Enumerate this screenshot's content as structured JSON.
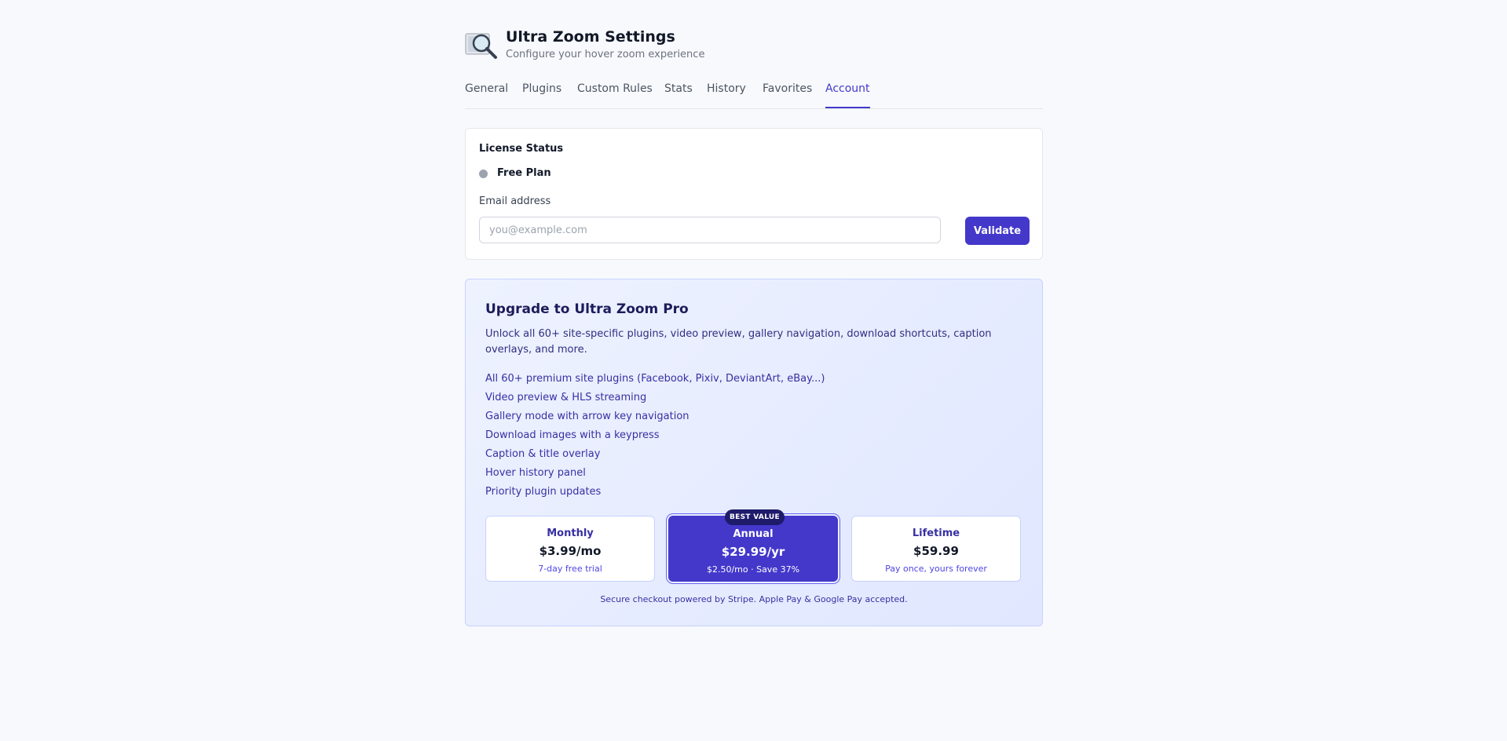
{
  "header": {
    "title": "Ultra Zoom Settings",
    "subtitle": "Configure your hover zoom experience",
    "logo_icon": "magnifier-over-image-icon"
  },
  "tabs": [
    {
      "label": "General",
      "active": false
    },
    {
      "label": "Plugins",
      "active": false
    },
    {
      "label": "Custom Rules",
      "active": false
    },
    {
      "label": "Stats",
      "active": false
    },
    {
      "label": "History",
      "active": false
    },
    {
      "label": "Favorites",
      "active": false
    },
    {
      "label": "Account",
      "active": true
    }
  ],
  "license": {
    "title": "License Status",
    "status": "Free Plan",
    "status_color": "#9ca3af",
    "email_label": "Email address",
    "email_value": "",
    "email_placeholder": "you@example.com",
    "validate_label": "Validate"
  },
  "upgrade": {
    "title": "Upgrade to Ultra Zoom Pro",
    "description": "Unlock all 60+ site-specific plugins, video preview, gallery navigation, download shortcuts, caption overlays, and more.",
    "features": [
      "All 60+ premium site plugins (Facebook, Pixiv, DeviantArt, eBay...)",
      "Video preview & HLS streaming",
      "Gallery mode with arrow key navigation",
      "Download images with a keypress",
      "Caption & title overlay",
      "Hover history panel",
      "Priority plugin updates"
    ],
    "plans": [
      {
        "name": "Monthly",
        "price": "$3.99/mo",
        "note": "7-day free trial"
      },
      {
        "name": "Annual",
        "price": "$29.99/yr",
        "note": "$2.50/mo · Save 37%",
        "badge": "BEST VALUE"
      },
      {
        "name": "Lifetime",
        "price": "$59.99",
        "note": "Pay once, yours forever"
      }
    ],
    "checkout_note": "Secure checkout powered by Stripe. Apple Pay & Google Pay accepted."
  },
  "colors": {
    "accent": "#4338ca",
    "background": "#f8f9fc",
    "badge": "#1e1b6b"
  }
}
